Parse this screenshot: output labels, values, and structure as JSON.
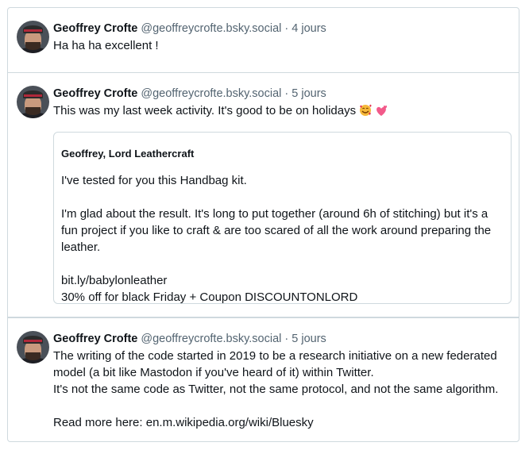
{
  "posts": [
    {
      "author": "Geoffrey Crofte",
      "handle": "@geoffreycrofte.bsky.social",
      "separator": "·",
      "time": "4 jours",
      "text": "Ha ha ha excellent !"
    },
    {
      "author": "Geoffrey Crofte",
      "handle": "@geoffreycrofte.bsky.social",
      "separator": "·",
      "time": "5 jours",
      "text": "This was my last week activity. It's good to be on holidays",
      "emojis": [
        "smiling-face-with-hearts-emoji",
        "two-hearts-emoji"
      ],
      "quote": {
        "author": "Geoffrey, Lord Leathercraft",
        "text": "I've tested for you this Handbag kit.\n\nI'm glad about the result. It's long to put together (around 6h of stitching) but it's a fun project if you like to craft & are too scared of all the work around preparing the leather.\n\nbit.ly/babylonleather\n30% off for black Friday + Coupon DISCOUNTONLORD"
      }
    },
    {
      "author": "Geoffrey Crofte",
      "handle": "@geoffreycrofte.bsky.social",
      "separator": "·",
      "time": "5 jours",
      "text": "The writing of the code started in 2019 to be a research initiative on a new federated model (a bit like Mastodon if you've heard of it) within Twitter.\nIt's not the same code as Twitter, not the same protocol, and not the same algorithm.\n\nRead more here: en.m.wikipedia.org/wiki/Bluesky"
    }
  ]
}
